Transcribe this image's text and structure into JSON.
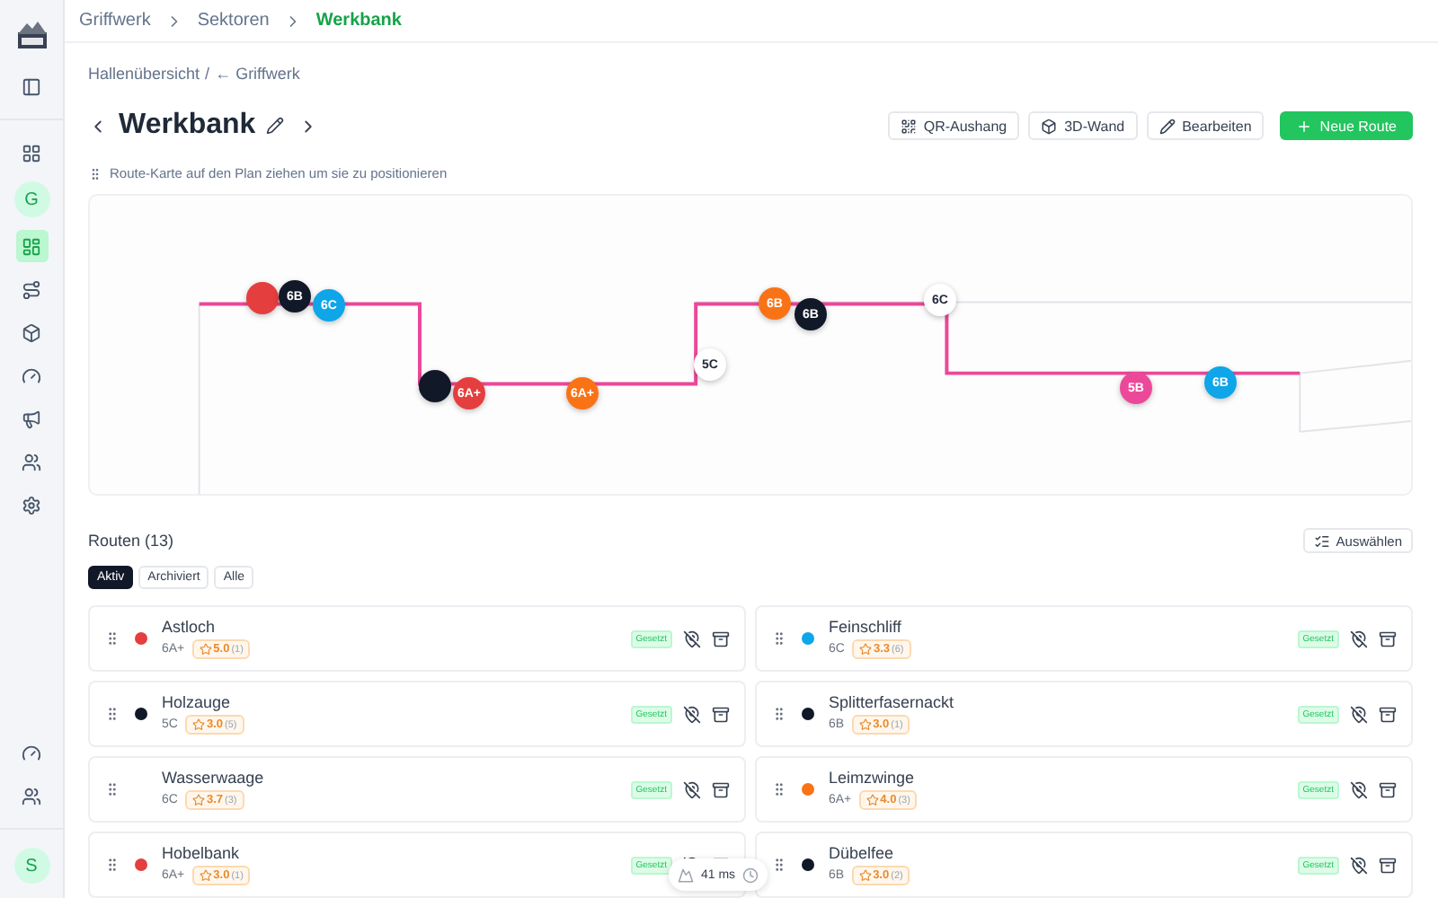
{
  "sidebar": {
    "top_items": [
      {
        "selected": false
      }
    ],
    "nav_items": [
      {
        "selected": false
      }
    ],
    "gym_avatar": "G",
    "sector_items": [
      {
        "selected": true
      },
      {
        "selected": false
      },
      {
        "selected": false
      },
      {
        "selected": false
      },
      {
        "selected": false
      },
      {
        "selected": false
      },
      {
        "selected": false
      }
    ],
    "bottom_items": [
      {
        "selected": false
      },
      {
        "selected": false
      }
    ],
    "user_avatar": "S"
  },
  "breadcrumb": [
    {
      "label": "Griffwerk",
      "current": false
    },
    {
      "label": "Sektoren",
      "current": false
    },
    {
      "label": "Werkbank",
      "current": true
    }
  ],
  "back_nav": {
    "hall": "Hallenübersicht",
    "separator": "/",
    "back": "← Griffwerk"
  },
  "title": "Werkbank",
  "actions": [
    {
      "kind": "qr",
      "label": "QR-Aushang"
    },
    {
      "kind": "wall",
      "label": "3D-Wand"
    },
    {
      "kind": "edit",
      "label": "Bearbeiten"
    },
    {
      "kind": "primary",
      "label": "Neue Route"
    }
  ],
  "hint": "Route-Karte auf den Plan ziehen um sie zu positionieren",
  "map_pins": [
    {
      "color": "#e53e3e"
    },
    {
      "label": "6B",
      "color": "#111827"
    },
    {
      "label": "6C",
      "color": "#0ea5e9"
    },
    {
      "color": "#111827"
    },
    {
      "label": "6A+",
      "color": "#e53e3e"
    },
    {
      "label": "6A+",
      "color": "#f97316"
    },
    {
      "label": "5C",
      "color": "#ffffff"
    },
    {
      "label": "6B",
      "color": "#f97316"
    },
    {
      "label": "6B",
      "color": "#111827"
    },
    {
      "label": "6C",
      "color": "#ffffff"
    },
    {
      "label": "5B",
      "color": "#ec4899"
    },
    {
      "label": "6B",
      "color": "#0ea5e9"
    }
  ],
  "routes_title": "Routen (13)",
  "select_button": "Auswählen",
  "filters": [
    {
      "label": "Aktiv",
      "selected": true
    },
    {
      "label": "Archiviert",
      "selected": false
    },
    {
      "label": "Alle",
      "selected": false
    }
  ],
  "routes": [
    {
      "name": "Astloch",
      "grade": "6A+",
      "rating": "5.0",
      "votes": "(1)",
      "status": "Gesetzt",
      "color": "#e53e3e"
    },
    {
      "name": "Feinschliff",
      "grade": "6C",
      "rating": "3.3",
      "votes": "(6)",
      "status": "Gesetzt",
      "color": "#0ea5e9"
    },
    {
      "name": "Holzauge",
      "grade": "5C",
      "rating": "3.0",
      "votes": "(5)",
      "status": "Gesetzt",
      "color": "#111827"
    },
    {
      "name": "Splitterfasernackt",
      "grade": "6B",
      "rating": "3.0",
      "votes": "(1)",
      "status": "Gesetzt",
      "color": "#111827"
    },
    {
      "name": "Wasserwaage",
      "grade": "6C",
      "rating": "3.7",
      "votes": "(3)",
      "status": "Gesetzt"
    },
    {
      "name": "Leimzwinge",
      "grade": "6A+",
      "rating": "4.0",
      "votes": "(3)",
      "status": "Gesetzt",
      "color": "#f97316"
    },
    {
      "name": "Hobelbank",
      "grade": "6A+",
      "rating": "3.0",
      "votes": "(1)",
      "status": "Gesetzt",
      "color": "#e53e3e"
    },
    {
      "name": "Dübelfee",
      "grade": "6B",
      "rating": "3.0",
      "votes": "(2)",
      "status": "Gesetzt",
      "color": "#111827"
    }
  ],
  "perf": {
    "time": "41 ms"
  }
}
